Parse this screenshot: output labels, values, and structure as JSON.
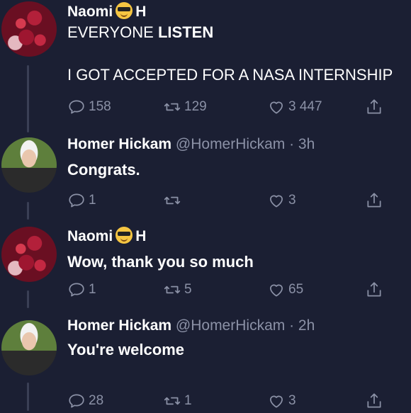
{
  "tweets": [
    {
      "name": "Naomi",
      "emoji": "sunglasses-emoji",
      "name_suffix": "H",
      "text_line1_prefix": "EVERYONE ",
      "text_line1_bold": "LISTEN",
      "text_line2": "I GOT ACCEPTED FOR A NASA INTERNSHIP",
      "replies": "158",
      "retweets": "129",
      "likes": "3 447"
    },
    {
      "name": "Homer Hickam",
      "handle": "@HomerHickam",
      "time": "· 3h",
      "text": "Congrats.",
      "replies": "1",
      "retweets": "",
      "likes": "3"
    },
    {
      "name": "Naomi",
      "emoji": "sunglasses-emoji",
      "name_suffix": "H",
      "text": "Wow, thank you so much",
      "replies": "1",
      "retweets": "5",
      "likes": "65"
    },
    {
      "name": "Homer Hickam",
      "handle": "@HomerHickam",
      "time": "· 2h",
      "text": "You're welcome",
      "replies": "28",
      "retweets": "1",
      "likes": "3"
    }
  ],
  "colors": {
    "background": "#1b1f33",
    "muted": "#8b91a6",
    "text": "#ffffff"
  }
}
